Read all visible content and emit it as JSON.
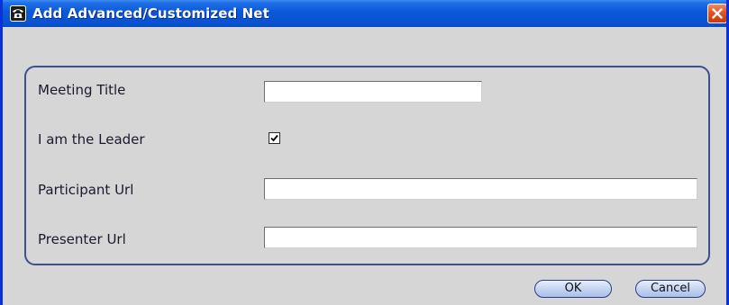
{
  "window": {
    "title": "Add Advanced/Customized Net",
    "icon": "telephone-icon",
    "close_icon": "close-icon"
  },
  "form": {
    "meeting_title": {
      "label": "Meeting Title",
      "value": ""
    },
    "leader": {
      "label": "I am the Leader",
      "checked": true
    },
    "participant_url": {
      "label": "Participant Url",
      "value": ""
    },
    "presenter_url": {
      "label": "Presenter Url",
      "value": ""
    }
  },
  "buttons": {
    "ok_label": "OK",
    "cancel_label": "Cancel"
  },
  "colors": {
    "titlebar": "#0a58d8",
    "window_border": "#0831d9",
    "panel_border": "#3c4f8f",
    "dialog_background": "#d6d6d6",
    "close_button": "#e5501f"
  }
}
